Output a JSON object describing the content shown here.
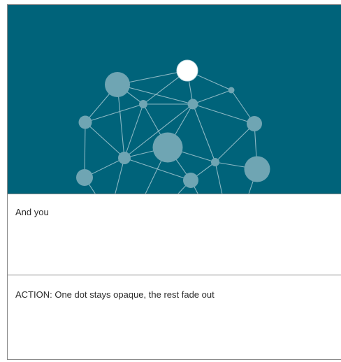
{
  "frame": {
    "background_color": "#00637a",
    "node_color": "#6fa5b3",
    "highlight_node_color": "#ffffff",
    "edge_color": "#8ab8c4"
  },
  "caption": {
    "text": "And you"
  },
  "action": {
    "text": "ACTION: One dot stays opaque, the rest fade out"
  }
}
